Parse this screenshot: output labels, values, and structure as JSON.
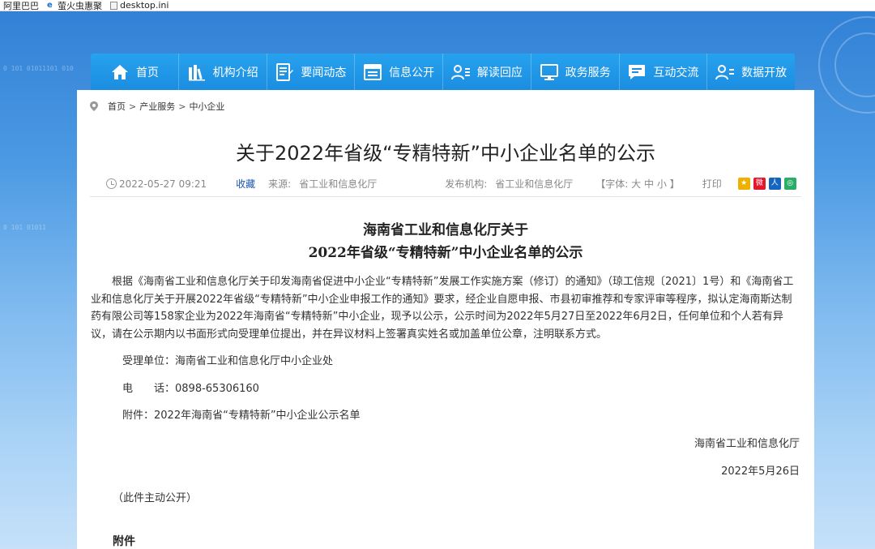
{
  "bookmarks": [
    {
      "label": "阿里巴巴",
      "icon": "none"
    },
    {
      "label": "萤火虫惠聚",
      "icon": "ie-icon"
    },
    {
      "label": "desktop.ini",
      "icon": "file-icon"
    }
  ],
  "nav": [
    {
      "label": "首页",
      "icon": "home-icon"
    },
    {
      "label": "机构介绍",
      "icon": "books-icon"
    },
    {
      "label": "要闻动态",
      "icon": "news-icon"
    },
    {
      "label": "信息公开",
      "icon": "info-panel-icon"
    },
    {
      "label": "解读回应",
      "icon": "user-list-icon"
    },
    {
      "label": "政务服务",
      "icon": "monitor-icon"
    },
    {
      "label": "互动交流",
      "icon": "chat-icon"
    },
    {
      "label": "数据开放",
      "icon": "user-data-icon"
    }
  ],
  "breadcrumb": [
    "首页",
    "产业服务",
    "中小企业"
  ],
  "article": {
    "title": "关于2022年省级“专精特新”中小企业名单的公示",
    "datetime": "2022-05-27 09:21",
    "collect": "收藏",
    "source_label": "来源:",
    "source": "省工业和信息化厅",
    "publisher_label": "发布机构:",
    "publisher": "省工业和信息化厅",
    "font_label": "【字体:",
    "font_large": "大",
    "font_medium": "中",
    "font_small": "小",
    "font_end": "】",
    "print": "打印"
  },
  "share": [
    {
      "name": "qzone-share-icon",
      "color": "#f0b000"
    },
    {
      "name": "weibo-share-icon",
      "color": "#e6162d"
    },
    {
      "name": "renren-share-icon",
      "color": "#1565c0"
    },
    {
      "name": "wechat-share-icon",
      "color": "#2aae67"
    }
  ],
  "doc": {
    "heading_line1": "海南省工业和信息化厅关于",
    "heading_line2": "2022年省级“专精特新”中小企业名单的公示",
    "body": "根据《海南省工业和信息化厅关于印发海南省促进中小企业“专精特新”发展工作实施方案（修订）的通知》（琼工信规〔2021〕1号）和《海南省工业和信息化厅关于开展2022年省级“专精特新”中小企业申报工作的通知》要求，经企业自愿申报、市县初审推荐和专家评审等程序，拟认定海南斯达制药有限公司等158家企业为2022年海南省“专精特新”中小企业，现予以公示，公示时间为2022年5月27日至2022年6月2日，任何单位和个人若有异议，请在公示期内以书面形式向受理单位提出，并在异议材料上签署真实姓名或加盖单位公章，注明联系方式。",
    "receiver": "受理单位：海南省工业和信息化厅中小企业处",
    "phone": "电　　话：0898-65306160",
    "attachment": "附件：2022年海南省“专精特新”中小企业公示名单",
    "signer": "海南省工业和信息化厅",
    "date": "2022年5月26日",
    "note": "（此件主动公开）",
    "attach_heading": "附件"
  }
}
